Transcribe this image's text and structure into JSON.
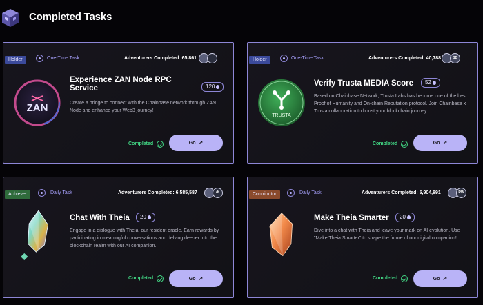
{
  "header": {
    "title": "Completed Tasks",
    "logo_icon": "cube-logo-icon"
  },
  "cards": [
    {
      "tag": "Holder",
      "tag_color": "#3b4a9b",
      "task_type": "One-Time Task",
      "adventurers_label": "Adventurers Completed:",
      "adventurers_count": "65,861",
      "avatars": [
        "",
        ""
      ],
      "title": "Experience ZAN Node RPC Service",
      "points": "120",
      "description": "Create a bridge to connect with the Chainbase network through ZAN Node and enhance your Web3 journey!",
      "status": "Completed",
      "go_label": "Go",
      "thumb_icon": "zan-logo-icon",
      "thumb_text": "ZAN"
    },
    {
      "tag": "Holder",
      "tag_color": "#3b4a9b",
      "task_type": "One-Time Task",
      "adventurers_label": "Adventurers Completed:",
      "adventurers_count": "40,788",
      "avatars": [
        "",
        "BB"
      ],
      "title": "Verify Trusta MEDIA Score",
      "points": "52",
      "description": "Based on Chainbase Network, Trusta Labs has become one of the best Proof of Humanity and On-chain Reputation protocol. Join Chainbase x Trusta collaboration to boost your blockchain journey.",
      "status": "Completed",
      "go_label": "Go",
      "thumb_icon": "trusta-logo-icon",
      "thumb_text": "TRUSTA"
    },
    {
      "tag": "Achiever",
      "tag_color": "#2f6b3b",
      "task_type": "Daily Task",
      "adventurers_label": "Adventurers Completed:",
      "adventurers_count": "6,585,587",
      "avatars": [
        "",
        "dt"
      ],
      "title": "Chat With Theia",
      "points": "20",
      "description": "Engage in a dialogue with Theia, our resident oracle. Earn rewards by participating in meaningful conversations and delving deeper into the blockchain realm with our AI companion.",
      "status": "Completed",
      "go_label": "Go",
      "thumb_icon": "crystal-icon",
      "thumb_text": ""
    },
    {
      "tag": "Contributor",
      "tag_color": "#8a4a2c",
      "task_type": "Daily Task",
      "adventurers_label": "Adventurers Completed:",
      "adventurers_count": "5,904,891",
      "avatars": [
        "",
        "RW"
      ],
      "title": "Make Theia Smarter",
      "points": "20",
      "description": "Dive into a chat with Theia and leave your mark on AI evolution. Use \"Make Theia Smarter\" to shape the future of our digital companion!",
      "status": "Completed",
      "go_label": "Go",
      "thumb_icon": "orange-crystal-icon",
      "thumb_text": ""
    }
  ]
}
